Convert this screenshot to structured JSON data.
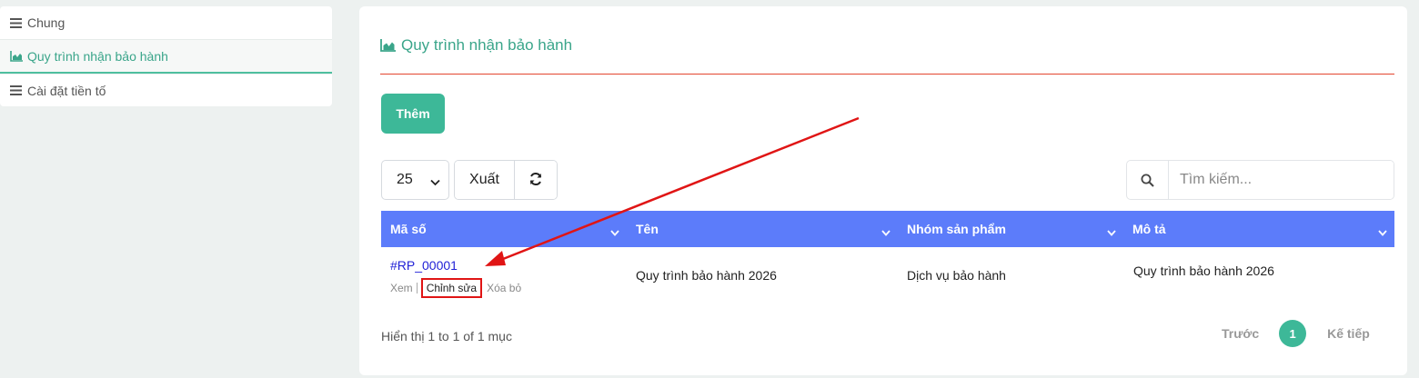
{
  "sidebar": {
    "items": [
      {
        "label": "Chung",
        "icon": "bars-icon"
      },
      {
        "label": "Quy trình nhận bảo hành",
        "icon": "area-chart-icon",
        "active": true
      },
      {
        "label": "Cài đặt tiền tố",
        "icon": "bars-icon"
      }
    ]
  },
  "panel": {
    "title": "Quy trình nhận bảo hành",
    "add_label": "Thêm",
    "per_page": "25",
    "export_label": "Xuất",
    "search_placeholder": "Tìm kiếm..."
  },
  "table": {
    "columns": [
      "Mã số",
      "Tên",
      "Nhóm sản phẩm",
      "Mô tả"
    ],
    "rows": [
      {
        "code": "#RP_00001",
        "name": "Quy trình bảo hành 2026",
        "group": "Dịch vụ bảo hành",
        "description": "Quy trình bảo hành 2026",
        "actions": {
          "view": "Xem",
          "edit": "Chỉnh sửa",
          "delete": "Xóa bỏ"
        }
      }
    ]
  },
  "footer": {
    "info": "Hiển thị 1 to 1 of 1 mục",
    "prev": "Trước",
    "page": "1",
    "next": "Kế tiếp"
  },
  "colors": {
    "accent": "#3db898",
    "header": "#5c7cfa",
    "divider": "#e3462f",
    "annotation": "#e01515"
  }
}
